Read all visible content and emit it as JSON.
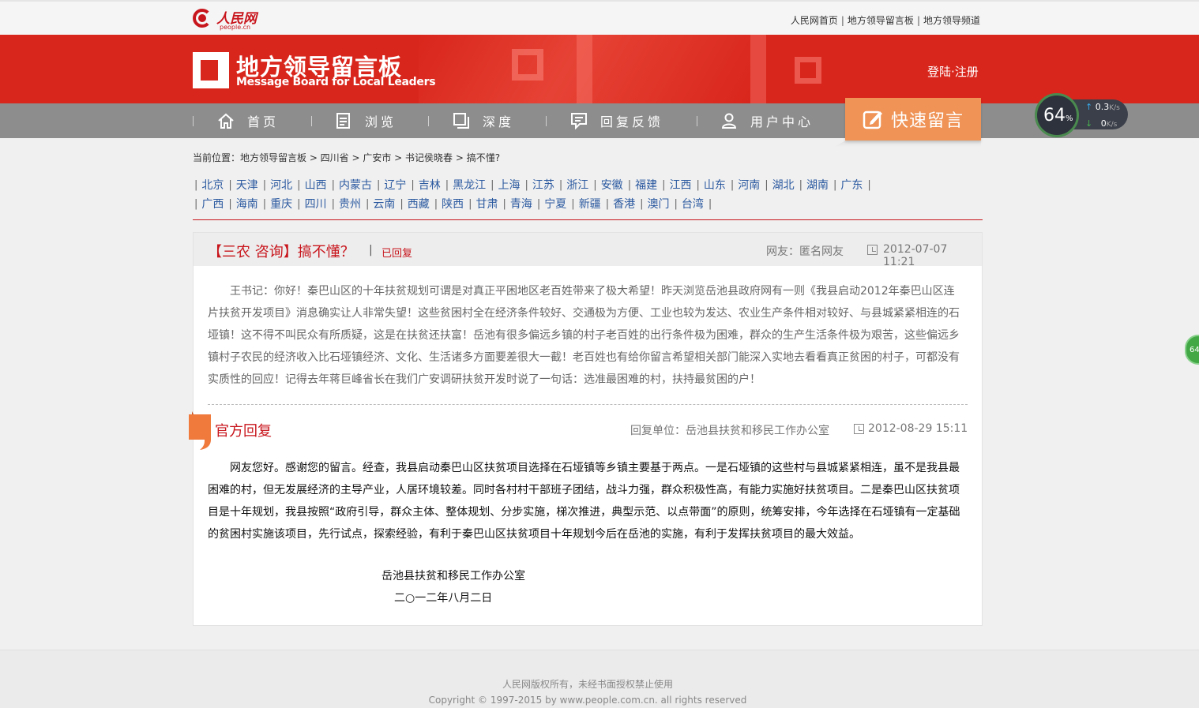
{
  "top": {
    "logo_cn": "人民网",
    "logo_en": "people.cn",
    "links": [
      "人民网首页",
      "地方领导留言板",
      "地方领导频道"
    ]
  },
  "header": {
    "brand_cn": "地方领导留言板",
    "brand_en": "Message Board for Local Leaders",
    "login": "登陆·注册"
  },
  "nav": {
    "items": [
      {
        "label": "首页",
        "icon": "home-icon"
      },
      {
        "label": "浏览",
        "icon": "document-icon"
      },
      {
        "label": "深度",
        "icon": "pages-icon"
      },
      {
        "label": "回复反馈",
        "icon": "comment-icon"
      },
      {
        "label": "用户中心",
        "icon": "user-icon"
      }
    ],
    "quick": "快速留言"
  },
  "speed": {
    "percent": "64",
    "pct_sign": "%",
    "up": "0.3",
    "down": "0",
    "unit": "K/s",
    "side_badge": "64"
  },
  "breadcrumb": "当前位置：地方领导留言板 > 四川省 > 广安市 > 书记侯晓春 > 搞不懂?",
  "provinces": {
    "row1": [
      "北京",
      "天津",
      "河北",
      "山西",
      "内蒙古",
      "辽宁",
      "吉林",
      "黑龙江",
      "上海",
      "江苏",
      "浙江",
      "安徽",
      "福建",
      "江西",
      "山东",
      "河南",
      "湖北",
      "湖南",
      "广东"
    ],
    "row2": [
      "广西",
      "海南",
      "重庆",
      "四川",
      "贵州",
      "云南",
      "西藏",
      "陕西",
      "甘肃",
      "青海",
      "宁夏",
      "新疆",
      "香港",
      "澳门",
      "台湾"
    ]
  },
  "message": {
    "title": "【三农 咨询】搞不懂？",
    "title_sep": "|",
    "status": "已回复",
    "author": "网友：匿名网友",
    "date": "2012-07-07 11:21",
    "body": "王书记：你好！秦巴山区的十年扶贫规划可谓是对真正平困地区老百姓带来了极大希望！昨天浏览岳池县政府网有一则《我县启动2012年秦巴山区连片扶贫开发项目》消息确实让人非常失望！这些贫困村全在经济条件较好、交通极为方便、工业也较为发达、农业生产条件相对较好、与县城紧紧相连的石垭镇！这不得不叫民众有所质疑，这是在扶贫还扶富！岳池有很多偏远乡镇的村子老百姓的出行条件极为困难，群众的生产生活条件极为艰苦，这些偏远乡镇村子农民的经济收入比石垭镇经济、文化、生活诸多方面要差很大一截！老百姓也有给你留言希望相关部门能深入实地去看看真正贫困的村子，可都没有实质性的回应！记得去年蒋巨峰省长在我们广安调研扶贫开发时说了一句话：选准最困难的村，扶持最贫困的户！"
  },
  "official": {
    "title": "官方回复",
    "unit": "回复单位：岳池县扶贫和移民工作办公室",
    "date": "2012-08-29 15:11",
    "body": "网友您好。感谢您的留言。经查，我县启动秦巴山区扶贫项目选择在石垭镇等乡镇主要基于两点。一是石垭镇的这些村与县城紧紧相连，虽不是我县最困难的村，但无发展经济的主导产业，人居环境较差。同时各村村干部班子团结，战斗力强，群众积极性高，有能力实施好扶贫项目。二是秦巴山区扶贫项目是十年规划，我县按照“政府引导，群众主体、整体规划、分步实施，梯次推进，典型示范、以点带面”的原则，统筹安排，今年选择在石垭镇有一定基础的贫困村实施该项目，先行试点，探索经验，有利于秦巴山区扶贫项目十年规划今后在岳池的实施，有利于发挥扶贫项目的最大效益。",
    "sign_org": "岳池县扶贫和移民工作办公室",
    "sign_date": "二○一二年八月二日"
  },
  "footer": {
    "line1": "人民网版权所有，未经书面授权禁止使用",
    "line2": "Copyright © 1997-2015 by www.people.com.cn. all rights reserved"
  },
  "colors": {
    "brand_red": "#d9261c",
    "nav_gray": "#8d8d8d",
    "quick_orange": "#ef9356",
    "link_blue": "#2c5aa0"
  }
}
